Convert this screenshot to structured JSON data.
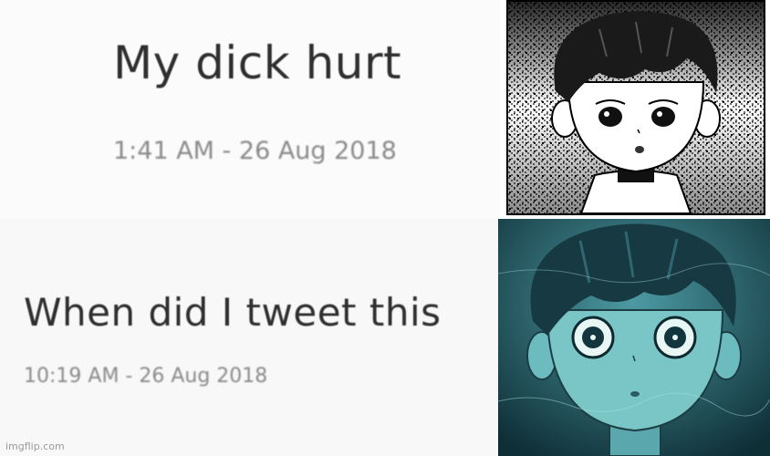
{
  "tweets": [
    {
      "text": "My dick hurt",
      "timestamp": "1:41 AM - 26 Aug 2018"
    },
    {
      "text": "When did I tweet this",
      "timestamp": "10:19 AM - 26 Aug 2018"
    }
  ],
  "watermark": "imgflip.com",
  "images": {
    "top": {
      "subject": "calm-boy-face-drawing",
      "style": "black-white-dither"
    },
    "bottom": {
      "subject": "shocked-boy-face-drawing",
      "style": "teal-underwater"
    }
  },
  "colors": {
    "background": "#ffffff",
    "text": "#2f2f2f",
    "timestamp": "#8a8a8a",
    "teal": "#2b6a74"
  }
}
